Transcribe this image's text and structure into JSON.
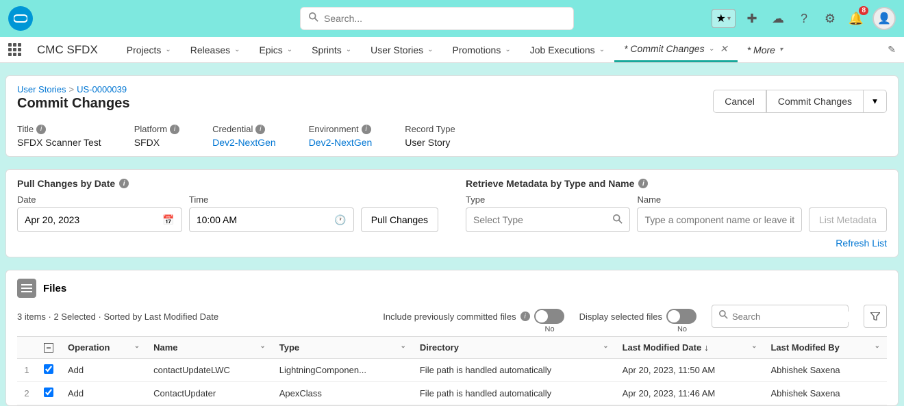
{
  "topbar": {
    "search_placeholder": "Search...",
    "notification_count": "8"
  },
  "nav": {
    "app_name": "CMC SFDX",
    "items": [
      "Projects",
      "Releases",
      "Epics",
      "Sprints",
      "User Stories",
      "Promotions",
      "Job Executions"
    ],
    "active_tab": "* Commit Changes",
    "more": "* More"
  },
  "breadcrumb": {
    "root": "User Stories",
    "current": "US-0000039"
  },
  "page_title": "Commit Changes",
  "actions": {
    "cancel": "Cancel",
    "commit": "Commit Changes"
  },
  "details": {
    "title_label": "Title",
    "title_value": "SFDX Scanner Test",
    "platform_label": "Platform",
    "platform_value": "SFDX",
    "credential_label": "Credential",
    "credential_value": "Dev2-NextGen",
    "environment_label": "Environment",
    "environment_value": "Dev2-NextGen",
    "recordtype_label": "Record Type",
    "recordtype_value": "User Story"
  },
  "pull": {
    "title": "Pull Changes by Date",
    "date_label": "Date",
    "date_value": "Apr 20, 2023",
    "time_label": "Time",
    "time_value": "10:00 AM",
    "button": "Pull Changes"
  },
  "retrieve": {
    "title": "Retrieve Metadata by Type and Name",
    "type_label": "Type",
    "type_placeholder": "Select Type",
    "name_label": "Name",
    "name_placeholder": "Type a component name or leave it empty",
    "button": "List Metadata",
    "refresh": "Refresh List"
  },
  "files": {
    "title": "Files",
    "status": "3 items · 2 Selected · Sorted by Last Modified Date",
    "include_label": "Include previously committed files",
    "display_label": "Display selected files",
    "toggle_off": "No",
    "search_placeholder": "Search",
    "columns": [
      "Operation",
      "Name",
      "Type",
      "Directory",
      "Last Modified Date",
      "Last Modifed By"
    ],
    "rows": [
      {
        "num": "1",
        "operation": "Add",
        "name": "contactUpdateLWC",
        "type": "LightningComponen...",
        "directory": "File path is handled automatically",
        "date": "Apr 20, 2023, 11:50 AM",
        "by": "Abhishek Saxena"
      },
      {
        "num": "2",
        "operation": "Add",
        "name": "ContactUpdater",
        "type": "ApexClass",
        "directory": "File path is handled automatically",
        "date": "Apr 20, 2023, 11:46 AM",
        "by": "Abhishek Saxena"
      }
    ]
  }
}
